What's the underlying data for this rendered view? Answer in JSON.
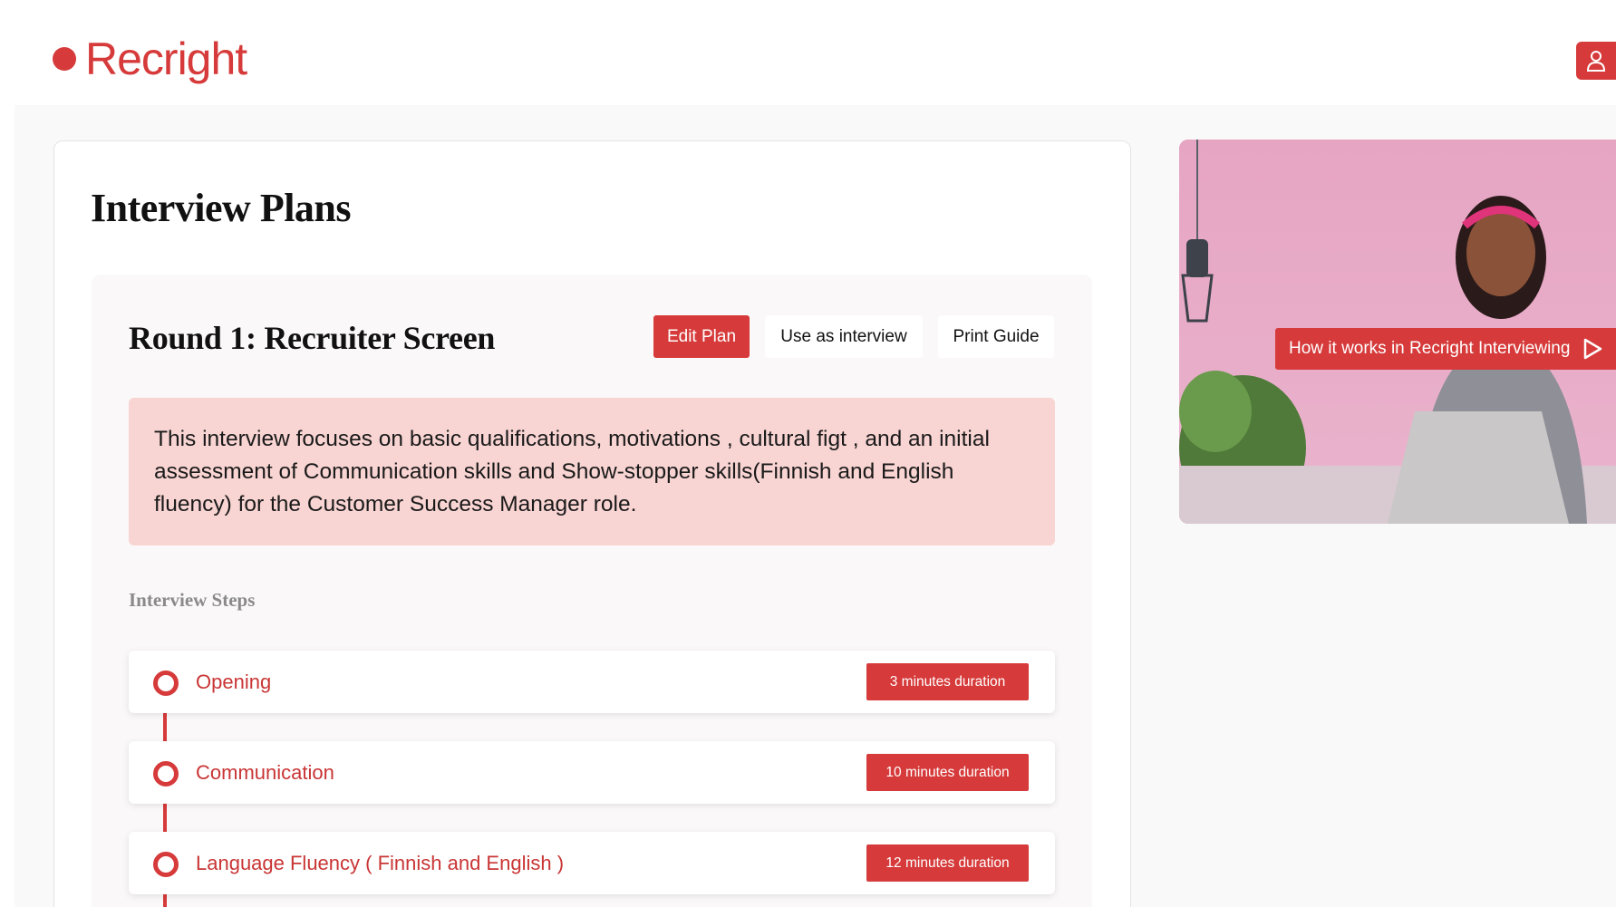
{
  "brand": {
    "name": "Recright",
    "accent": "#d63a3a"
  },
  "page": {
    "title": "Interview Plans"
  },
  "plan": {
    "round_title": "Round 1:  Recruiter Screen",
    "actions": {
      "edit": "Edit Plan",
      "use": "Use as interview",
      "print": "Print Guide"
    },
    "description": "This interview focuses on basic qualifications, motivations , cultural figt , and an initial assessment of Communication skills and Show-stopper skills(Finnish and English fluency) for the Customer Success Manager role.",
    "steps_label": "Interview Steps",
    "steps": [
      {
        "name": "Opening",
        "duration": "3 minutes duration"
      },
      {
        "name": "Communication",
        "duration": "10 minutes duration"
      },
      {
        "name": "Language Fluency ( Finnish and English )",
        "duration": "12 minutes duration"
      }
    ]
  },
  "video": {
    "cta_label": "How it works in Recright Interviewing",
    "icon": "play-icon"
  },
  "header": {
    "user_icon": "user-icon"
  }
}
